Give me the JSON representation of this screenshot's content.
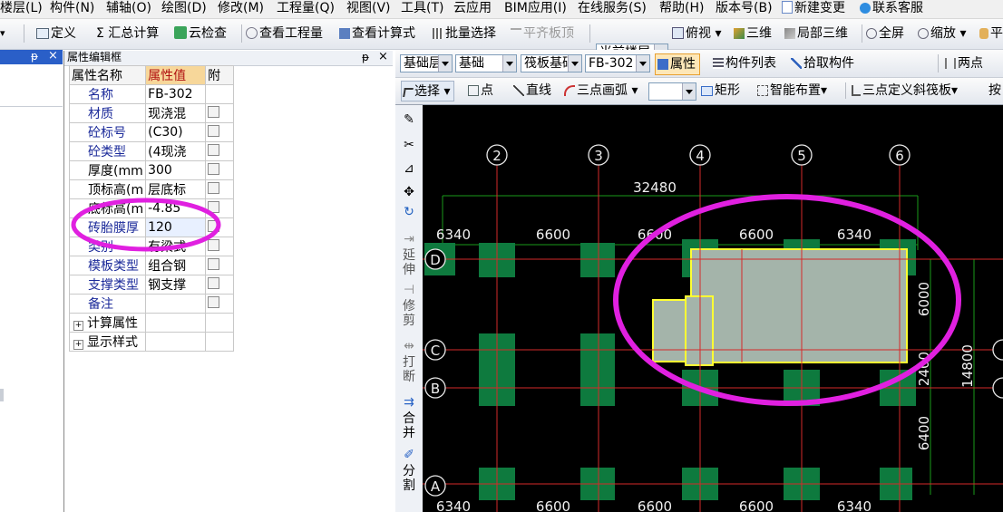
{
  "menubar": [
    "楼层(L)",
    "构件(N)",
    "辅轴(O)",
    "绘图(D)",
    "修改(M)",
    "工程量(Q)",
    "视图(V)",
    "工具(T)",
    "云应用",
    "BIM应用(I)",
    "在线服务(S)",
    "帮助(H)",
    "版本号(B)",
    "新建变更",
    "联系客服"
  ],
  "toolbar1": [
    "定义",
    "Σ 汇总计算",
    "云检查",
    "查看工程量",
    "查看计算式",
    "批量选择",
    "平齐板顶",
    "当前楼层",
    "俯视",
    "三维",
    "局部三维",
    "全屏",
    "缩放",
    "平"
  ],
  "toolbar2": {
    "floor_combo": "基础层",
    "category_combo": "基础",
    "type_combo": "筏板基础",
    "item_combo": "FB-302",
    "buttons": [
      "属性",
      "构件列表",
      "拾取构件",
      "两点"
    ]
  },
  "toolbar3": [
    "选择",
    "点",
    "直线",
    "三点画弧",
    "矩形",
    "智能布置",
    "三点定义斜筏板",
    "按"
  ],
  "property_panel": {
    "left_tab_pin": "ᵽ",
    "left_tab_close": "×",
    "title": "属性编辑框",
    "pin": "ᵽ",
    "close": "×",
    "headers": [
      "属性名称",
      "属性值",
      "附"
    ],
    "rows": [
      {
        "name": "名称",
        "value": "FB-302",
        "checkbox": false
      },
      {
        "name": "材质",
        "value": "现浇混",
        "checkbox": true
      },
      {
        "name": "砼标号",
        "value": "(C30)",
        "checkbox": true
      },
      {
        "name": "砼类型",
        "value": "(4现浇",
        "checkbox": true
      },
      {
        "name": "厚度(mm",
        "value": "300",
        "checkbox": true
      },
      {
        "name": "顶标高(m",
        "value": "层底标",
        "checkbox": true
      },
      {
        "name": "底标高(m",
        "value": "-4.85",
        "checkbox": true
      },
      {
        "name": "砖胎膜厚",
        "value": "120",
        "checkbox": true
      },
      {
        "name": "类别",
        "value": "有梁式",
        "checkbox": true
      },
      {
        "name": "模板类型",
        "value": "组合钢",
        "checkbox": true
      },
      {
        "name": "支撑类型",
        "value": "钢支撑",
        "checkbox": true
      },
      {
        "name": "备注",
        "value": "",
        "checkbox": true
      }
    ],
    "groups": [
      "计算属性",
      "显示样式"
    ]
  },
  "vertical_tools": [
    "延伸",
    "修剪",
    "打断",
    "合并",
    "分割"
  ],
  "cad": {
    "axis_numbers": [
      "2",
      "3",
      "4",
      "5",
      "6"
    ],
    "axis_letters": [
      "D",
      "C",
      "B",
      "A"
    ],
    "total_dim": "32480",
    "top_dims": [
      "6340",
      "6600",
      "6600",
      "6600",
      "6340"
    ],
    "bottom_dims": [
      "6340",
      "6600",
      "6600",
      "6600",
      "6340"
    ],
    "right_dims": [
      "6000",
      "2400",
      "6400"
    ],
    "right_total": "14800"
  },
  "colors": {
    "highlight_ellipse": "#e020e0",
    "slab": "#a4b4aa",
    "slab_edge": "#ffff33",
    "column": "#0e7a3e",
    "grid": "#d42a2a",
    "dim": "#1a9a1a"
  }
}
